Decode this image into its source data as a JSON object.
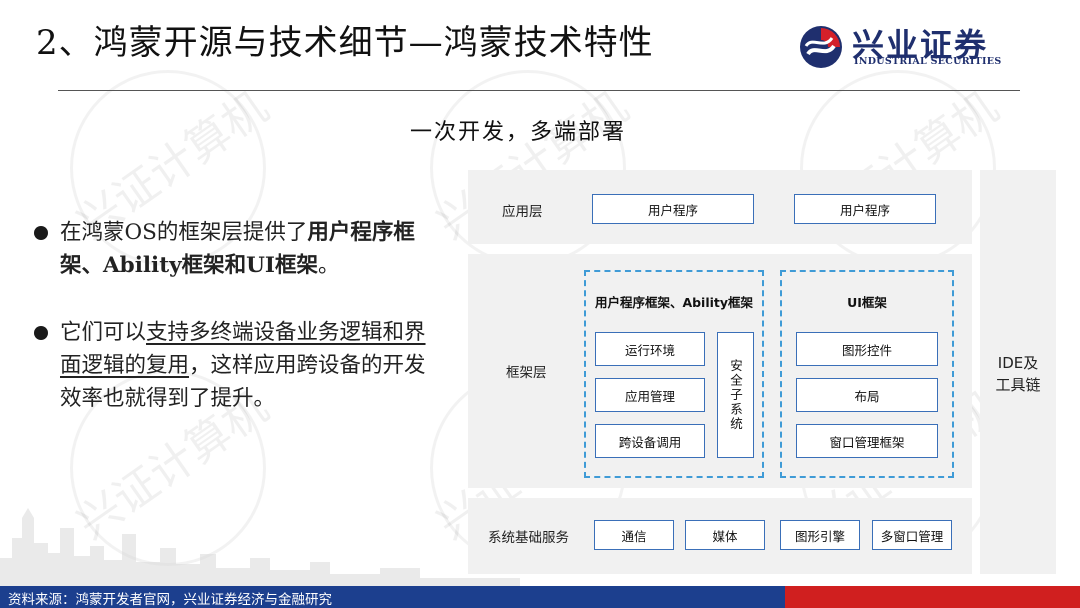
{
  "header": {
    "title": "2、鸿蒙开源与技术细节—鸿蒙技术特性",
    "logo_cn": "兴业证券",
    "logo_en": "INDUSTRIAL SECURITIES"
  },
  "watermark": "兴证计算机",
  "subtitle": "一次开发，多端部署",
  "bullets": [
    {
      "parts": [
        "在鸿蒙OS的框架层提供了",
        "用户程序框架、Ability框架和UI框架",
        "。"
      ]
    },
    {
      "parts": [
        "它们可以",
        "支持多终端设备业务逻辑和界面逻辑的复用",
        "，这样应用跨设备的开发效率也就得到了提升。"
      ]
    }
  ],
  "diagram": {
    "app_layer": {
      "label": "应用层",
      "boxes": [
        "用户程序",
        "用户程序"
      ]
    },
    "framework_layer": {
      "label": "框架层",
      "group1": {
        "title": "用户程序框架、Ability框架",
        "boxes": [
          "运行环境",
          "应用管理",
          "跨设备调用"
        ],
        "side": "安全子系统"
      },
      "group2": {
        "title": "UI框架",
        "boxes": [
          "图形控件",
          "布局",
          "窗口管理框架"
        ]
      }
    },
    "ide": {
      "line1": "IDE及",
      "line2": "工具链"
    },
    "base_layer": {
      "label": "系统基础服务",
      "boxes": [
        "通信",
        "媒体",
        "图形引擎",
        "多窗口管理"
      ]
    }
  },
  "footer": {
    "source": "资料来源：鸿蒙开发者官网，兴业证券经济与金融研究"
  },
  "colors": {
    "footer_blue": "#1c3f8e",
    "footer_red": "#d01f1f",
    "box_border": "#3a6fb8",
    "dashed_border": "#3f9bd6",
    "logo_navy": "#1f2f6e",
    "logo_red": "#d4202a"
  }
}
